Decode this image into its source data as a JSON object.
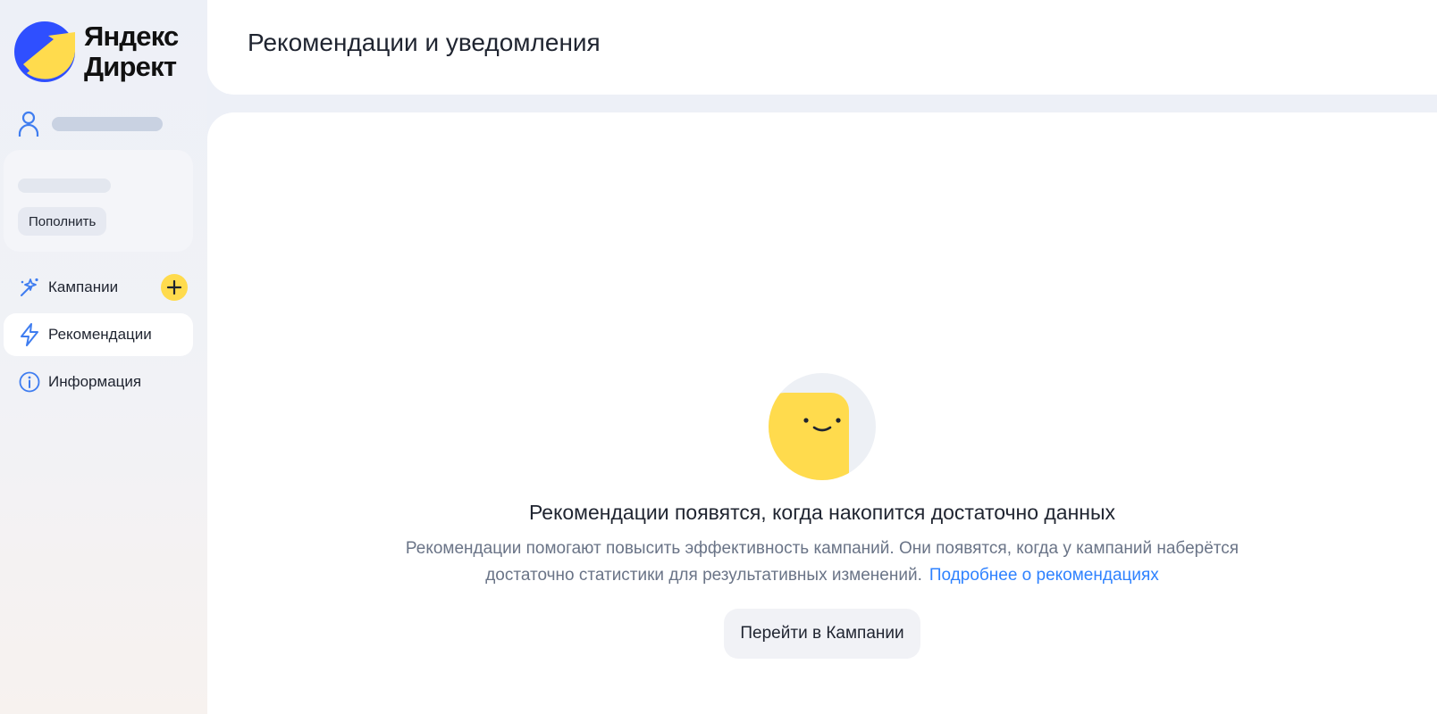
{
  "brand": {
    "logo_line1": "Яндекс",
    "logo_line2": "Директ",
    "logo_icon": "yandex-direct-arrow-icon",
    "accent_yellow": "#ffdb4d",
    "accent_blue": "#2f4fff"
  },
  "sidebar": {
    "profile_icon": "user-icon",
    "topup_label": "Пополнить",
    "items": [
      {
        "label": "Кампании",
        "icon": "sparkle-wand-icon",
        "active": false
      },
      {
        "label": "Рекомендации",
        "icon": "lightning-icon",
        "active": true
      },
      {
        "label": "Информация",
        "icon": "info-icon",
        "active": false
      }
    ],
    "add_icon": "plus-icon"
  },
  "header": {
    "title": "Рекомендации и уведомления"
  },
  "empty_state": {
    "illustration": "smiling-face-illustration",
    "title": "Рекомендации появятся, когда накопится достаточно данных",
    "description": "Рекомендации помогают повысить эффективность кампаний. Они появятся, когда у кампаний наберётся достаточно статистики для результативных изменений.",
    "link_label": "Подробнее о рекомендациях",
    "button_label": "Перейти в Кампании",
    "link_color": "#2f82ff"
  }
}
